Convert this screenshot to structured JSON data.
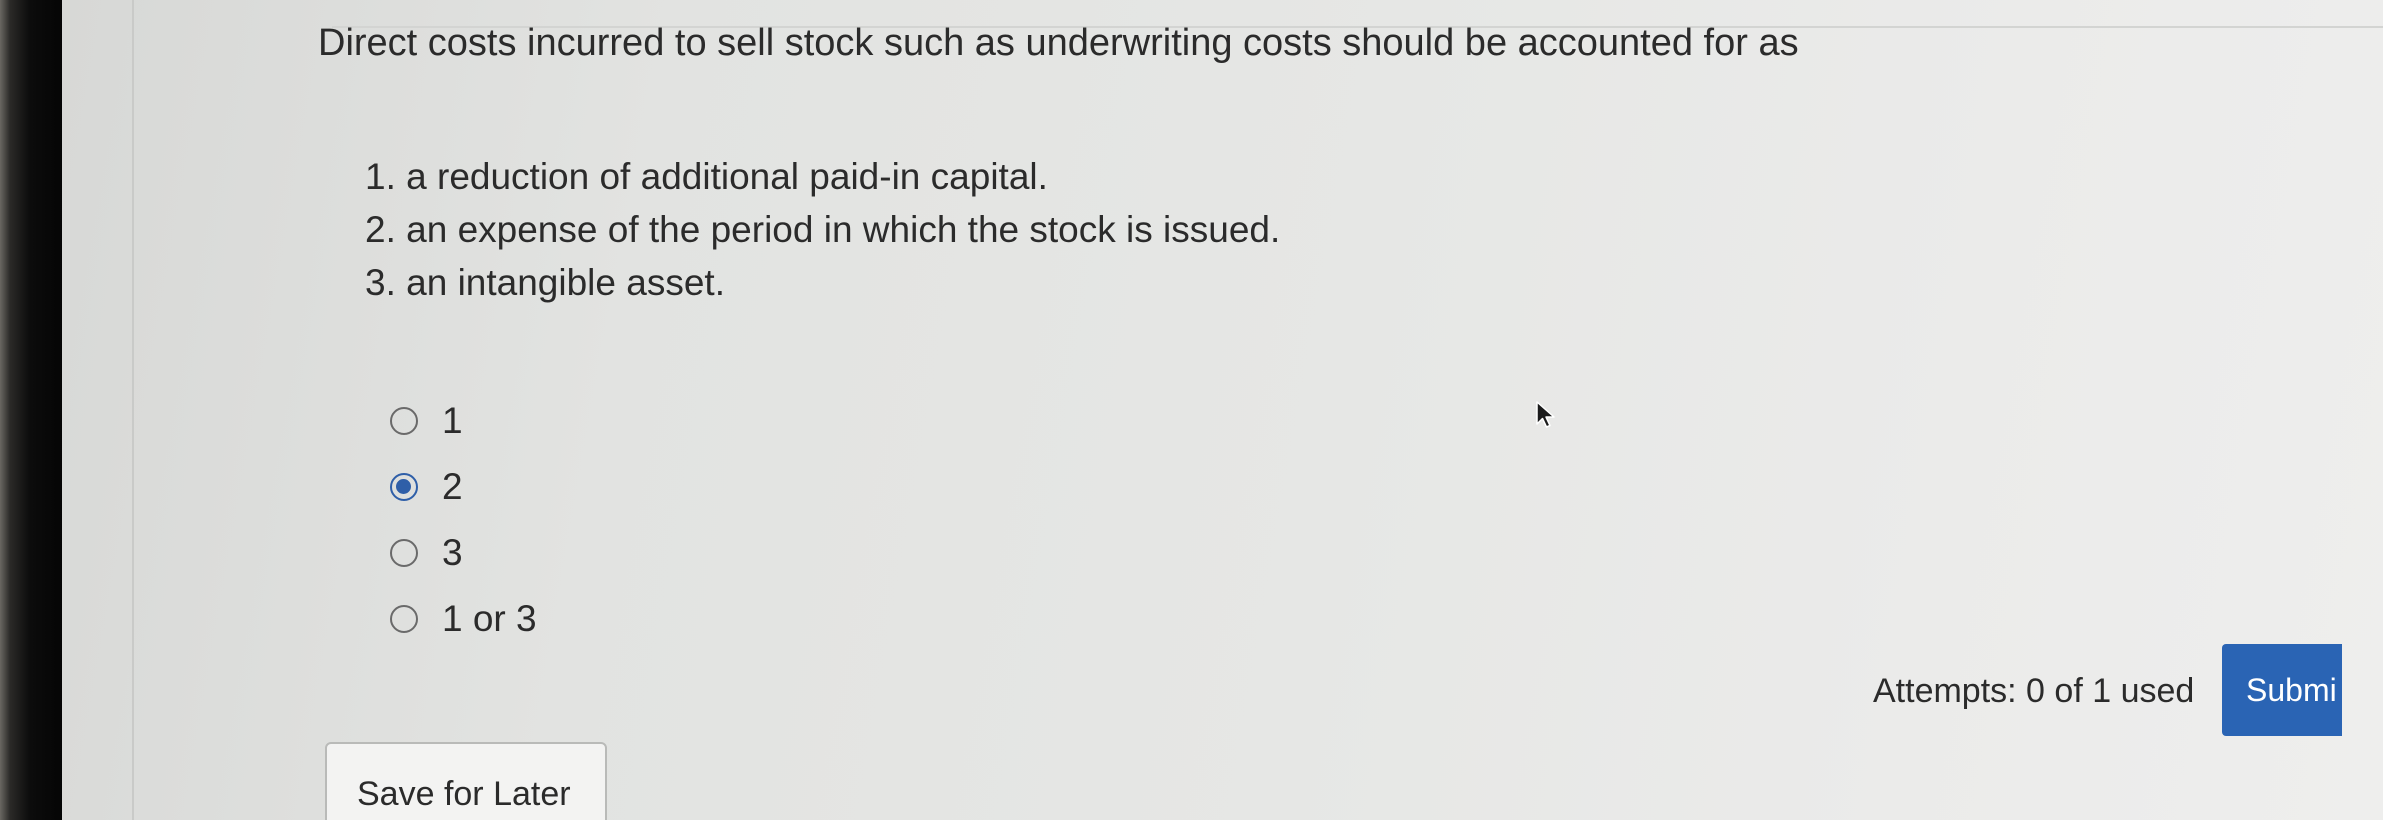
{
  "question": {
    "prompt": "Direct costs incurred to sell stock such as underwriting costs should be accounted for as",
    "statements": [
      "1. a reduction of additional paid-in capital.",
      "2. an expense of the period in which the stock is issued.",
      "3. an intangible asset."
    ]
  },
  "options": [
    {
      "label": "1",
      "selected": false
    },
    {
      "label": "2",
      "selected": true
    },
    {
      "label": "3",
      "selected": false
    },
    {
      "label": "1 or 3",
      "selected": false
    }
  ],
  "footer": {
    "attempts": "Attempts: 0 of 1 used",
    "submit_label": "Submi",
    "save_label": "Save for Later"
  },
  "colors": {
    "accent": "#2a64b4",
    "radio_selected": "#2f5fa8"
  },
  "icons": {
    "cursor": "mouse-pointer-icon"
  }
}
